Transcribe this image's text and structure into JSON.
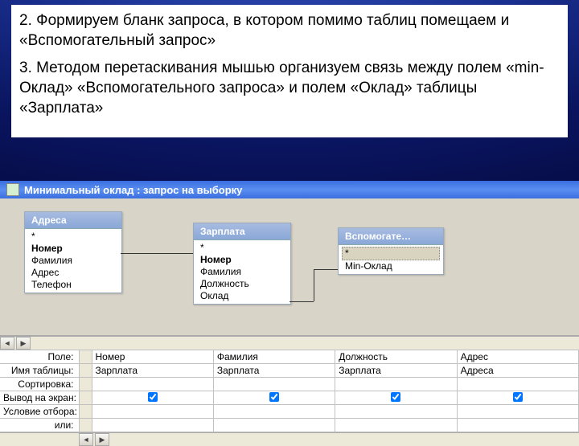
{
  "slide": {
    "para2": "2. Формируем бланк запроса, в котором помимо таблиц помещаем и «Вспомогательный запрос»",
    "para3": "3. Методом перетаскивания мышью организуем связь между полем «min-Оклад» «Вспомогательного запроса» и полем «Оклад» таблицы «Зарплата»"
  },
  "window": {
    "title": "Минимальный оклад : запрос на выборку"
  },
  "tables": [
    {
      "title": "Адреса",
      "fields": [
        "*",
        "Номер",
        "Фамилия",
        "Адрес",
        "Телефон"
      ]
    },
    {
      "title": "Зарплата",
      "fields": [
        "*",
        "Номер",
        "Фамилия",
        "Должность",
        "Оклад"
      ]
    },
    {
      "title": "Вспомогате…",
      "fields": [
        "*",
        "Min-Оклад"
      ]
    }
  ],
  "grid": {
    "labels": [
      "Поле:",
      "Имя таблицы:",
      "Сортировка:",
      "Вывод на экран:",
      "Условие отбора:",
      "или:"
    ],
    "cols": [
      {
        "field": "Номер",
        "table": "Зарплата",
        "show": true
      },
      {
        "field": "Фамилия",
        "table": "Зарплата",
        "show": true
      },
      {
        "field": "Должность",
        "table": "Зарплата",
        "show": true
      },
      {
        "field": "Адрес",
        "table": "Адреса",
        "show": true
      }
    ]
  }
}
